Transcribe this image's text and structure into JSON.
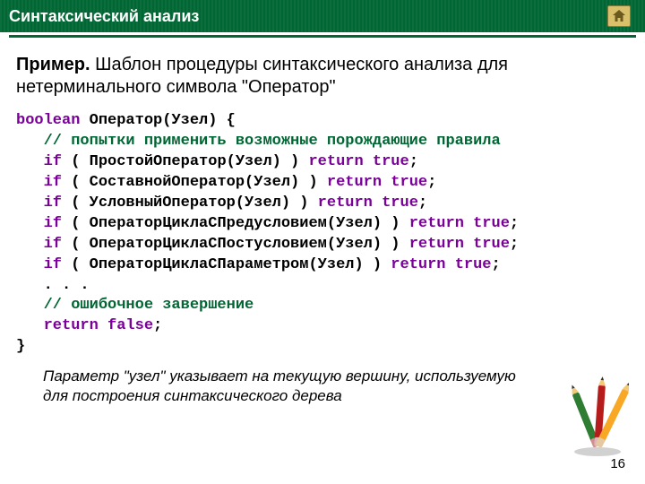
{
  "header": {
    "title": "Синтаксический анализ",
    "home_icon": "home-icon"
  },
  "intro": {
    "label": "Пример.",
    "rest": " Шаблон процедуры синтаксического анализа для нетерминального символа \"Оператор\""
  },
  "code": {
    "l1_kw": "boolean",
    "l1_rest": " Оператор(Узел) {",
    "l2_cmt": "   // попытки применить возможные порождающие правила",
    "l3_if": "   if",
    "l3_rest": " ( ПростойОператор(Узел) ) ",
    "l3_ret": "return true",
    "l3_end": ";",
    "l4_if": "   if",
    "l4_rest": " ( СоставнойОператор(Узел) ) ",
    "l4_ret": "return true",
    "l4_end": ";",
    "l5_if": "   if",
    "l5_rest": " ( УсловныйОператор(Узел) ) ",
    "l5_ret": "return true",
    "l5_end": ";",
    "l6_if": "   if",
    "l6_rest": " ( ОператорЦиклаСПредусловием(Узел) ) ",
    "l6_ret": "return true",
    "l6_end": ";",
    "l7_if": "   if",
    "l7_rest": " ( ОператорЦиклаСПостусловием(Узел) ) ",
    "l7_ret": "return true",
    "l7_end": ";",
    "l8_if": "   if",
    "l8_rest": " ( ОператорЦиклаСПараметром(Узел) ) ",
    "l8_ret": "return true",
    "l8_end": ";",
    "l9": "   . . .",
    "l10_cmt": "   // ошибочное завершение",
    "l11_ret": "   return false",
    "l11_end": ";",
    "l12": "}"
  },
  "footnote": "Параметр \"узел\" указывает на текущую вершину, используемую для построения синтаксического дерева",
  "page": "16"
}
